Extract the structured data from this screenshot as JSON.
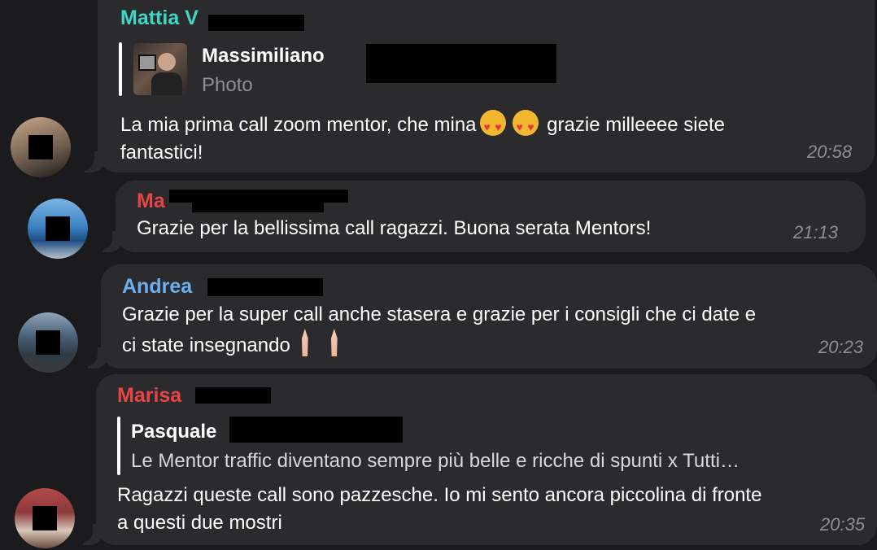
{
  "colors": {
    "background": "#1b1b1d",
    "bubble": "#2b2b2d",
    "name_teal": "#3fd6c6",
    "name_red": "#e64545",
    "name_blue": "#6aaef0"
  },
  "messages": [
    {
      "sender": "Mattia V",
      "reply": {
        "name": "Massimiliano",
        "text": "Photo",
        "thumbnail_icon": "photo-thumbnail"
      },
      "text_before": "La mia prima call zoom mentor, che mina",
      "emoji": [
        "heart-eyes-emoji",
        "heart-eyes-emoji"
      ],
      "text_after": " grazie milleeee siete\nfantastici!",
      "time": "20:58"
    },
    {
      "sender": "Ma",
      "text": "Grazie per la bellissima call ragazzi. Buona serata Mentors!",
      "time": "21:13"
    },
    {
      "sender": "Andrea",
      "text_before": "Grazie per la super call anche stasera e grazie per i consigli che ci date e\nci state insegnando",
      "emoji": [
        "folded-hands-emoji",
        "folded-hands-emoji"
      ],
      "time": "20:23"
    },
    {
      "sender": "Marisa",
      "reply": {
        "name": "Pasquale",
        "text": "Le Mentor traffic diventano sempre più belle e ricche di spunti x Tutti…"
      },
      "text": "Ragazzi queste call sono pazzesche. Io mi sento ancora piccolina di fronte\na questi due mostri",
      "time": "20:35"
    }
  ]
}
